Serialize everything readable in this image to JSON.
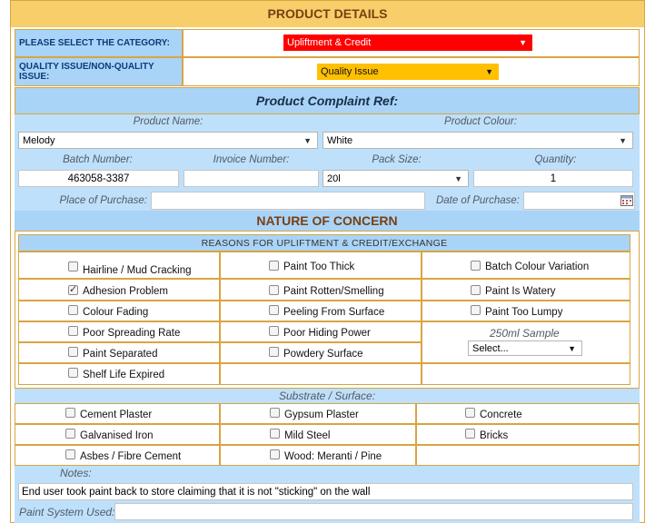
{
  "header": {
    "title": "PRODUCT DETAILS"
  },
  "category": {
    "label": "PLEASE SELECT THE CATEGORY:",
    "value": "Upliftment & Credit",
    "color": "#ff0000"
  },
  "quality": {
    "label": "QUALITY ISSUE/NON-QUALITY ISSUE:",
    "value": "Quality Issue",
    "color": "#ffc000"
  },
  "complaint": {
    "title": "Product Complaint Ref:",
    "product_name_label": "Product Name:",
    "product_name_value": "Melody",
    "product_colour_label": "Product Colour:",
    "product_colour_value": "White",
    "batch_label": "Batch Number:",
    "batch_value": "463058-3387",
    "invoice_label": "Invoice Number:",
    "invoice_value": "",
    "pack_label": "Pack Size:",
    "pack_value": "20l",
    "quantity_label": "Quantity:",
    "quantity_value": "1",
    "place_label": "Place of Purchase:",
    "place_value": "",
    "date_label": "Date of Purchase:",
    "date_value": ""
  },
  "nature": {
    "title": "NATURE OF CONCERN",
    "reasons_title": "REASONS FOR UPLIFTMENT & CREDIT/EXCHANGE",
    "reasons": [
      {
        "label": "Hairline / Mud Cracking",
        "checked": false
      },
      {
        "label": "Paint Too Thick",
        "checked": false
      },
      {
        "label": "Batch Colour Variation",
        "checked": false
      },
      {
        "label": "Adhesion Problem",
        "checked": true
      },
      {
        "label": "Paint Rotten/Smelling",
        "checked": false
      },
      {
        "label": "Paint Is Watery",
        "checked": false
      },
      {
        "label": "Colour Fading",
        "checked": false
      },
      {
        "label": "Peeling From Surface",
        "checked": false
      },
      {
        "label": "Paint Too Lumpy",
        "checked": false
      },
      {
        "label": "Poor Spreading Rate",
        "checked": false
      },
      {
        "label": "Poor Hiding Power",
        "checked": false
      },
      {
        "label": "Paint Separated",
        "checked": false
      },
      {
        "label": "Powdery Surface",
        "checked": false
      },
      {
        "label": "Shelf Life Expired",
        "checked": false
      }
    ],
    "sample_label": "250ml Sample",
    "sample_value": "Select..."
  },
  "substrate": {
    "title": "Substrate / Surface:",
    "items": [
      {
        "label": "Cement Plaster",
        "checked": false
      },
      {
        "label": "Gypsum Plaster",
        "checked": false
      },
      {
        "label": "Concrete",
        "checked": false
      },
      {
        "label": "Galvanised Iron",
        "checked": false
      },
      {
        "label": "Mild Steel",
        "checked": false
      },
      {
        "label": "Bricks",
        "checked": false
      },
      {
        "label": "Asbes / Fibre Cement",
        "checked": false
      },
      {
        "label": "Wood: Meranti / Pine",
        "checked": false
      }
    ]
  },
  "notes": {
    "label": "Notes:",
    "value": "End user took paint back to store claiming that it is not \"sticking\" on the wall"
  },
  "paint_system": {
    "label": "Paint System Used:",
    "value": ""
  }
}
